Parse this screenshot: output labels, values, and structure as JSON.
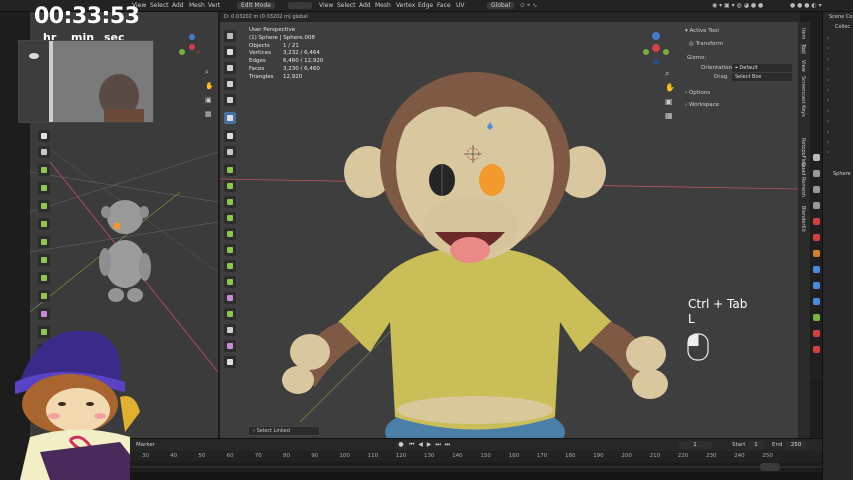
{
  "timer": {
    "value": "00:33:53",
    "labels": [
      "hr",
      "min",
      "sec"
    ]
  },
  "top_menu": {
    "left_items": [
      "View",
      "Select",
      "Add",
      "Mesh",
      "Vert"
    ],
    "left_select_box": "Select Box",
    "mode": "Edit Mode",
    "main_items": [
      "View",
      "Select",
      "Add",
      "Mesh",
      "Vertex",
      "Edge",
      "Face",
      "UV"
    ],
    "transform_orientation": "Global"
  },
  "measure_text": "D: 0.03202 m (0.03202 m) global",
  "viewport_info": {
    "title": "User Perspective",
    "subtitle": "(1) Sphere | Sphere.008",
    "stats": [
      {
        "label": "Objects",
        "value": "1 / 21"
      },
      {
        "label": "Vertices",
        "value": "3,232 / 6,464"
      },
      {
        "label": "Edges",
        "value": "6,460 / 12,920"
      },
      {
        "label": "Faces",
        "value": "3,230 / 6,460"
      },
      {
        "label": "Triangles",
        "value": "12,920"
      }
    ]
  },
  "tool_panel": {
    "active_tool": "Active Tool",
    "transform": "Transform",
    "gizmo": "Gizmo:",
    "orientation_label": "Orientation",
    "orientation_value": "Default",
    "drag_label": "Drag",
    "drag_value": "Select Box",
    "options": "Options",
    "workspace": "Workspace"
  },
  "side_tabs": [
    "Item",
    "Tool",
    "View",
    "Screencast Keys",
    "RetopoFlow",
    "Quad Remesh",
    "BlenderKit"
  ],
  "outliner": {
    "title": "Scene Co",
    "collection": "Collec",
    "object": "Sphere"
  },
  "shortcut_overlay": {
    "line1": "Ctrl + Tab",
    "line2": "L"
  },
  "select_linked": "Select Linked",
  "timeline": {
    "marker_label": "Marker",
    "current_frame": "1",
    "start_label": "Start",
    "start_value": "1",
    "end_label": "End",
    "end_value": "250",
    "ticks": [
      "30",
      "40",
      "50",
      "60",
      "70",
      "80",
      "90",
      "100",
      "110",
      "120",
      "130",
      "140",
      "150",
      "160",
      "170",
      "180",
      "190",
      "200",
      "210",
      "220",
      "230",
      "240",
      "250"
    ]
  },
  "colors": {
    "viewport_bg": "#3e3e3e",
    "accent_blue": "#4a90d9",
    "orange_selection": "#f29a2e",
    "shirt": "#c9be58",
    "skin": "#d8c79f",
    "fur": "#7e5a45"
  }
}
